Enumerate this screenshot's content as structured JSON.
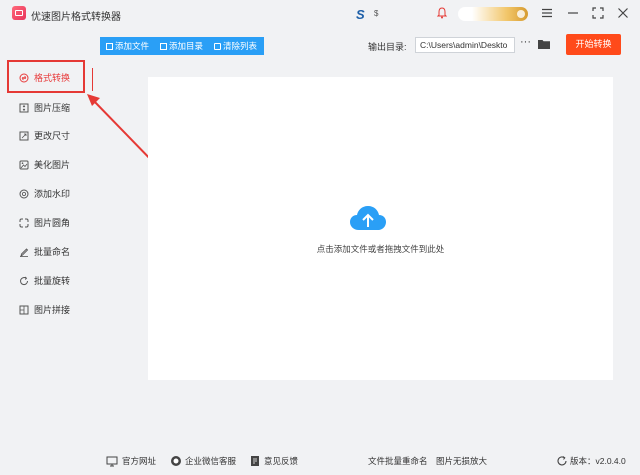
{
  "app": {
    "title": "优速图片格式转换器"
  },
  "toolbar": {
    "add_file": "添加文件",
    "add_dir": "添加目录",
    "clear_list": "清除列表",
    "output_label": "输出目录:",
    "output_path": "C:\\Users\\admin\\Deskto",
    "more": "···",
    "start": "开始转换"
  },
  "sidebar": {
    "items": [
      {
        "label": "格式转换",
        "icon": "format-convert-icon"
      },
      {
        "label": "图片压缩",
        "icon": "compress-icon"
      },
      {
        "label": "更改尺寸",
        "icon": "resize-icon"
      },
      {
        "label": "美化图片",
        "icon": "beautify-icon"
      },
      {
        "label": "添加水印",
        "icon": "watermark-icon"
      },
      {
        "label": "图片圆角",
        "icon": "round-corner-icon"
      },
      {
        "label": "批量命名",
        "icon": "rename-icon"
      },
      {
        "label": "批量旋转",
        "icon": "rotate-icon"
      },
      {
        "label": "图片拼接",
        "icon": "stitch-icon"
      }
    ]
  },
  "dropzone": {
    "hint": "点击添加文件或者拖拽文件到此处"
  },
  "footer": {
    "website": "官方网址",
    "wechat": "企业微信客服",
    "feedback": "意见反馈",
    "batch_rename": "文件批量重命名",
    "lossless_zoom": "图片无损放大",
    "version": "版本：v2.0.4.0"
  },
  "colors": {
    "accent": "#2a9ff6",
    "start": "#ff4a1a",
    "highlight": "#e53935",
    "active": "#e83b3b"
  }
}
